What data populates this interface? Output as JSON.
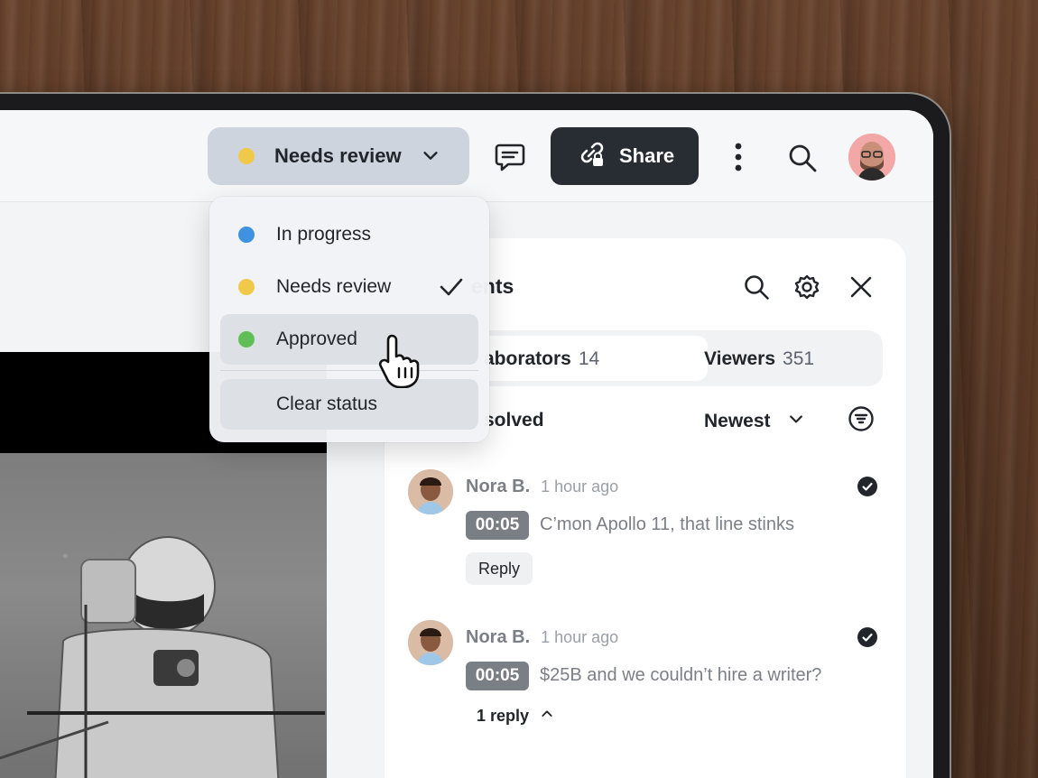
{
  "colors": {
    "progress": "#3e92e0",
    "review": "#f0c94a",
    "approved": "#5fbe56",
    "dark_button": "#272d33",
    "stamp": "#7a7f86"
  },
  "toolbar": {
    "status_label": "Needs review",
    "status_icon": "chevron-down-icon",
    "comment_icon": "comment-icon",
    "share_label": "Share",
    "share_icon": "link-lock-icon",
    "more_icon": "more-vertical-icon",
    "search_icon": "search-icon"
  },
  "status_menu": {
    "items": [
      {
        "label": "In progress",
        "color": "#3e92e0"
      },
      {
        "label": "Needs review",
        "color": "#f0c94a",
        "selected": true
      },
      {
        "label": "Approved",
        "color": "#5fbe56",
        "hovered": true
      }
    ],
    "clear_label": "Clear status"
  },
  "comments_panel": {
    "title": "ents",
    "tabs": [
      {
        "label": "aborators",
        "count": "14"
      },
      {
        "label": "Viewers",
        "count": "351"
      }
    ],
    "filter_label": "solved",
    "sort_label": "Newest",
    "comments": [
      {
        "author": "Nora B.",
        "time": "1 hour ago",
        "timestamp": "00:05",
        "text": "C’mon Apollo 11, that line stinks",
        "action": "Reply"
      },
      {
        "author": "Nora B.",
        "time": "1 hour ago",
        "timestamp": "00:05",
        "text": "$25B and we couldn’t hire a writer?",
        "replies": "1 reply"
      }
    ]
  }
}
